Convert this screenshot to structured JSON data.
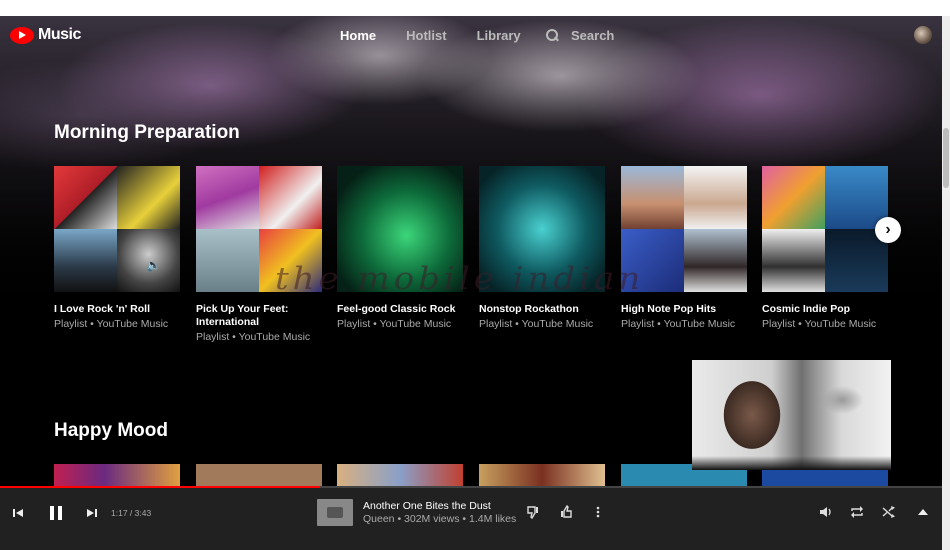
{
  "nav": {
    "app_name": "Music",
    "links": [
      "Home",
      "Hotlist",
      "Library"
    ],
    "search_label": "Search"
  },
  "sections": [
    {
      "title": "Morning Preparation",
      "cards": [
        {
          "title": "I Love Rock 'n' Roll",
          "subtitle": "Playlist • YouTube Music"
        },
        {
          "title": "Pick Up Your Feet: International",
          "subtitle": "Playlist • YouTube Music"
        },
        {
          "title": "Feel-good Classic Rock",
          "subtitle": "Playlist • YouTube Music"
        },
        {
          "title": "Nonstop Rockathon",
          "subtitle": "Playlist • YouTube Music"
        },
        {
          "title": "High Note Pop Hits",
          "subtitle": "Playlist • YouTube Music"
        },
        {
          "title": "Cosmic Indie Pop",
          "subtitle": "Playlist • YouTube Music"
        }
      ]
    },
    {
      "title": "Happy Mood"
    }
  ],
  "watermark": "the mobile indian",
  "player": {
    "progress": 0.34,
    "time": "1:17 / 3:43",
    "song_title": "Another One Bites the Dust",
    "song_subtitle": "Queen • 302M views • 1.4M likes"
  },
  "colors": {
    "accent": "#ff0000",
    "player_bg": "#212121",
    "background": "#000000"
  },
  "icons": [
    "previous-icon",
    "pause-icon",
    "next-icon",
    "dislike-icon",
    "like-icon",
    "more-icon",
    "volume-icon",
    "repeat-icon",
    "shuffle-icon",
    "expand-icon",
    "chevron-right-icon",
    "search-icon"
  ]
}
